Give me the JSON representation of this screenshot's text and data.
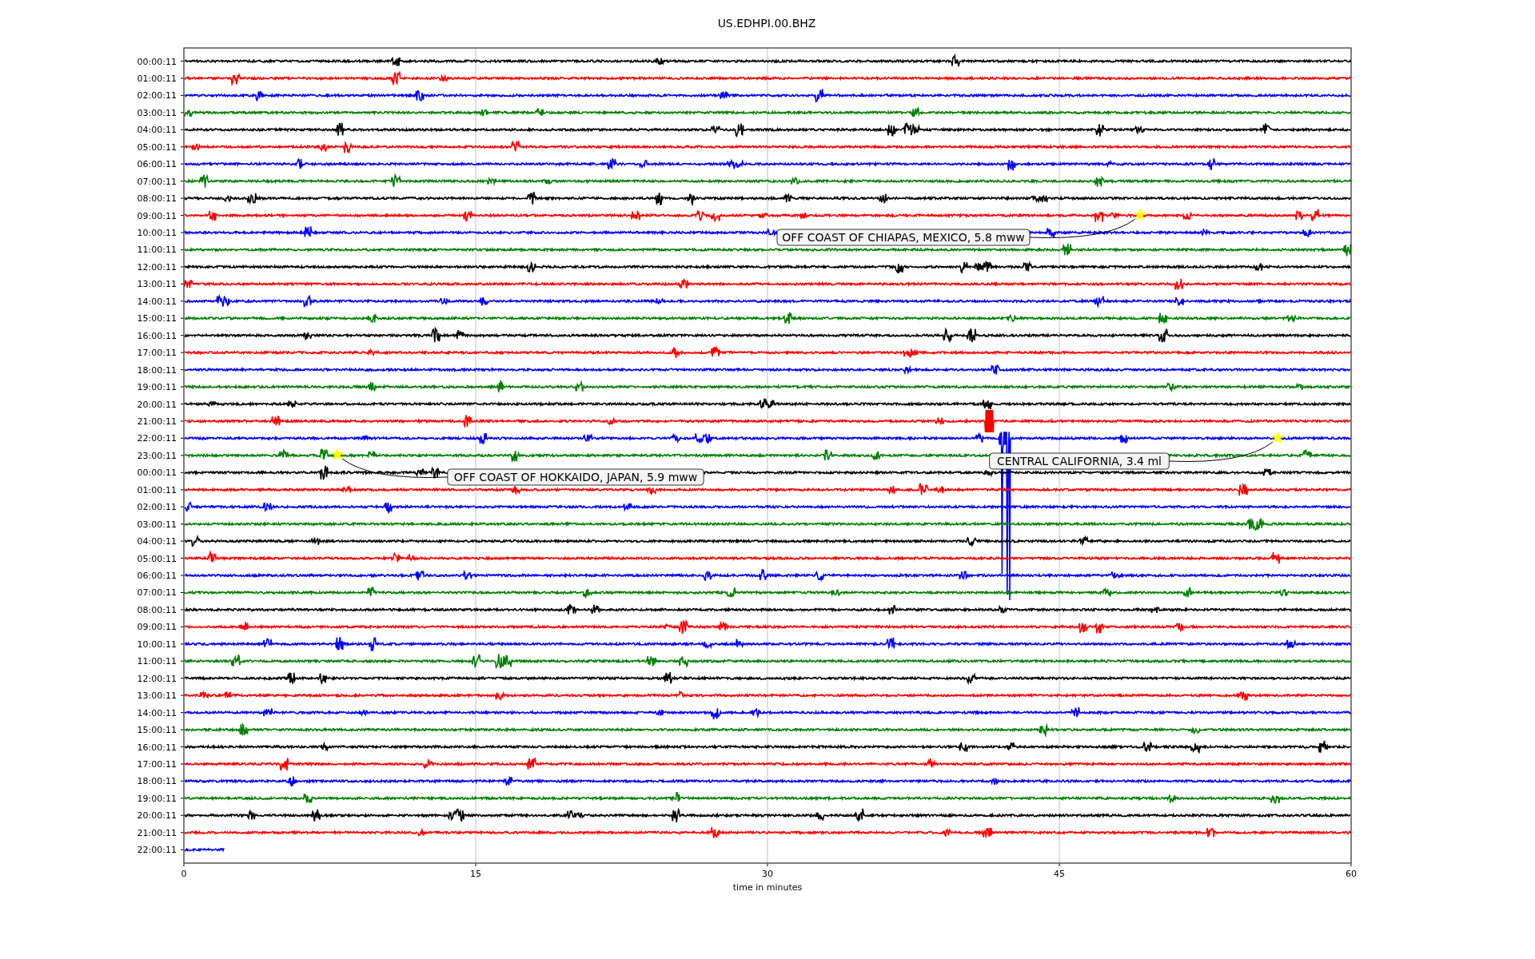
{
  "title": "US.EDHPI.00.BHZ",
  "x_axis": {
    "label": "time in minutes",
    "ticks": [
      "0",
      "15",
      "30",
      "45",
      "60"
    ]
  },
  "traces": [
    {
      "label": "00:00:11",
      "color": "#000000",
      "level": 1
    },
    {
      "label": "01:00:11",
      "color": "#ff0000",
      "level": 1
    },
    {
      "label": "02:00:11",
      "color": "#0000ff",
      "level": 1
    },
    {
      "label": "03:00:11",
      "color": "#008000",
      "level": 1
    },
    {
      "label": "04:00:11",
      "color": "#000000",
      "level": 1
    },
    {
      "label": "05:00:11",
      "color": "#ff0000",
      "level": 1
    },
    {
      "label": "06:00:11",
      "color": "#0000ff",
      "level": 1
    },
    {
      "label": "07:00:11",
      "color": "#008000",
      "level": 1
    },
    {
      "label": "08:00:11",
      "color": "#000000",
      "level": 1
    },
    {
      "label": "09:00:11",
      "color": "#ff0000",
      "level": 1
    },
    {
      "label": "10:00:11",
      "color": "#0000ff",
      "level": 1
    },
    {
      "label": "11:00:11",
      "color": "#008000",
      "level": 1
    },
    {
      "label": "12:00:11",
      "color": "#000000",
      "level": 1
    },
    {
      "label": "13:00:11",
      "color": "#ff0000",
      "level": 1
    },
    {
      "label": "14:00:11",
      "color": "#0000ff",
      "level": 1
    },
    {
      "label": "15:00:11",
      "color": "#008000",
      "level": 1
    },
    {
      "label": "16:00:11",
      "color": "#000000",
      "level": 1
    },
    {
      "label": "17:00:11",
      "color": "#ff0000",
      "level": 1
    },
    {
      "label": "18:00:11",
      "color": "#0000ff",
      "level": 1
    },
    {
      "label": "19:00:11",
      "color": "#008000",
      "level": 1
    },
    {
      "label": "20:00:11",
      "color": "#000000",
      "level": 1
    },
    {
      "label": "21:00:11",
      "color": "#ff0000",
      "level": 1
    },
    {
      "label": "22:00:11",
      "color": "#0000ff",
      "level": 1
    },
    {
      "label": "23:00:11",
      "color": "#008000",
      "level": 1
    },
    {
      "label": "00:00:11",
      "color": "#000000",
      "level": 1
    },
    {
      "label": "01:00:11",
      "color": "#ff0000",
      "level": 1
    },
    {
      "label": "02:00:11",
      "color": "#0000ff",
      "level": 1
    },
    {
      "label": "03:00:11",
      "color": "#008000",
      "level": 1
    },
    {
      "label": "04:00:11",
      "color": "#000000",
      "level": 1
    },
    {
      "label": "05:00:11",
      "color": "#ff0000",
      "level": 1
    },
    {
      "label": "06:00:11",
      "color": "#0000ff",
      "level": 1
    },
    {
      "label": "07:00:11",
      "color": "#008000",
      "level": 1
    },
    {
      "label": "08:00:11",
      "color": "#000000",
      "level": 1
    },
    {
      "label": "09:00:11",
      "color": "#ff0000",
      "level": 1
    },
    {
      "label": "10:00:11",
      "color": "#0000ff",
      "level": 1
    },
    {
      "label": "11:00:11",
      "color": "#008000",
      "level": 1
    },
    {
      "label": "12:00:11",
      "color": "#000000",
      "level": 1
    },
    {
      "label": "13:00:11",
      "color": "#ff0000",
      "level": 1
    },
    {
      "label": "14:00:11",
      "color": "#0000ff",
      "level": 1
    },
    {
      "label": "15:00:11",
      "color": "#008000",
      "level": 1
    },
    {
      "label": "16:00:11",
      "color": "#000000",
      "level": 1
    },
    {
      "label": "17:00:11",
      "color": "#ff0000",
      "level": 1
    },
    {
      "label": "18:00:11",
      "color": "#0000ff",
      "level": 1
    },
    {
      "label": "19:00:11",
      "color": "#008000",
      "level": 1
    },
    {
      "label": "20:00:11",
      "color": "#000000",
      "level": 1
    },
    {
      "label": "21:00:11",
      "color": "#ff0000",
      "level": 1
    },
    {
      "label": "22:00:11",
      "color": "#0000ff",
      "level": 0.035
    }
  ],
  "annotations": [
    {
      "text": "OFF COAST OF CHIAPAS, MEXICO, 5.8 mww"
    },
    {
      "text": "CENTRAL CALIFORNIA, 3.4 ml"
    },
    {
      "text": "OFF COAST OF HOKKAIDO, JAPAN, 5.9 mww"
    }
  ]
}
